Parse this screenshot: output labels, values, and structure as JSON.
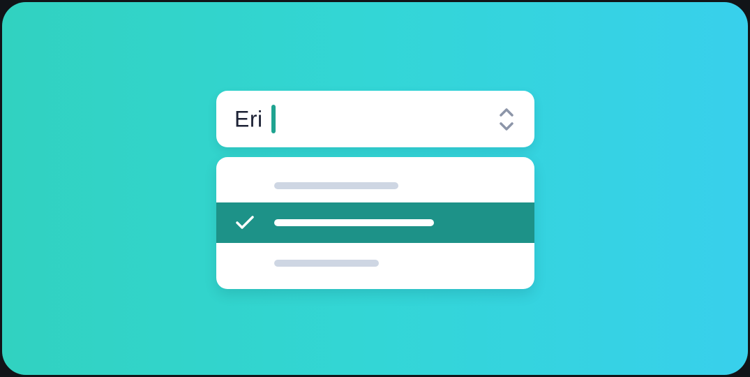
{
  "combobox": {
    "value": "Eri",
    "toggle_icon": "chevron-up-down-icon"
  },
  "dropdown": {
    "options": [
      {
        "state": "unselected"
      },
      {
        "state": "selected",
        "check_icon": "checkmark-icon"
      },
      {
        "state": "unselected"
      }
    ]
  },
  "colors": {
    "background_gradient_start": "#31d2c0",
    "background_gradient_end": "#38d0ec",
    "accent": "#1d9288",
    "caret": "#1fa390",
    "placeholder_bar": "#ced6e3",
    "text": "#1d2235"
  }
}
